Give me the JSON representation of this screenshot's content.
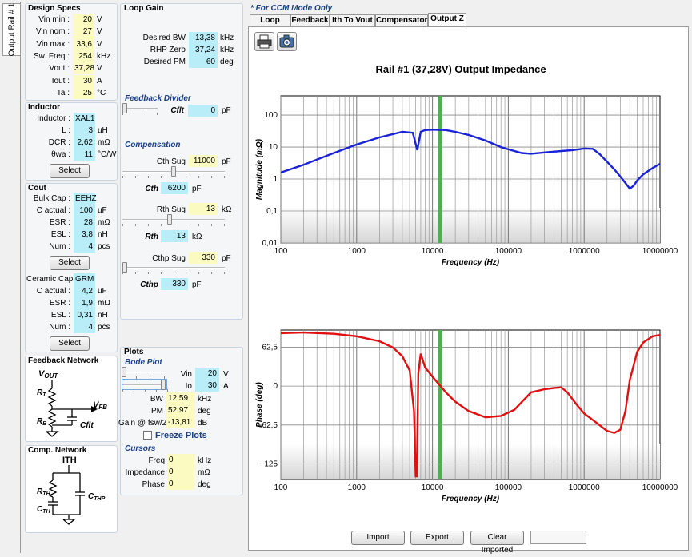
{
  "side_tab": "Output Rail # 1",
  "design_specs": {
    "title": "Design Specs",
    "rows": [
      {
        "label": "Vin min :",
        "value": "20",
        "unit": "V"
      },
      {
        "label": "Vin nom :",
        "value": "27",
        "unit": "V"
      },
      {
        "label": "Vin max :",
        "value": "33,6",
        "unit": "V"
      },
      {
        "label": "Sw. Freq :",
        "value": "254",
        "unit": "kHz"
      },
      {
        "label": "Vout :",
        "value": "37,28",
        "unit": "V"
      },
      {
        "label": "Iout :",
        "value": "30",
        "unit": "A"
      },
      {
        "label": "Ta :",
        "value": "25",
        "unit": "°C"
      }
    ]
  },
  "inductor": {
    "title": "Inductor",
    "rows": [
      {
        "label": "Inductor :",
        "value": "XAL1",
        "unit": ""
      },
      {
        "label": "L :",
        "value": "3",
        "unit": "uH"
      },
      {
        "label": "DCR :",
        "value": "2,62",
        "unit": "mΩ"
      },
      {
        "label": "θwa :",
        "value": "11",
        "unit": "°C/W"
      }
    ],
    "select": "Select"
  },
  "cout": {
    "title": "Cout",
    "bulk_rows": [
      {
        "label": "Bulk Cap :",
        "value": "EEHZ",
        "unit": ""
      },
      {
        "label": "C actual :",
        "value": "100",
        "unit": "uF"
      },
      {
        "label": "ESR :",
        "value": "28",
        "unit": "mΩ"
      },
      {
        "label": "ESL :",
        "value": "3,8",
        "unit": "nH"
      },
      {
        "label": "Num :",
        "value": "4",
        "unit": "pcs"
      }
    ],
    "bulk_select": "Select",
    "ceramic_rows": [
      {
        "label": "Ceramic Cap :",
        "value": "GRM",
        "unit": ""
      },
      {
        "label": "C actual :",
        "value": "4,2",
        "unit": "uF"
      },
      {
        "label": "ESR :",
        "value": "1,9",
        "unit": "mΩ"
      },
      {
        "label": "ESL :",
        "value": "0,31",
        "unit": "nH"
      },
      {
        "label": "Num :",
        "value": "4",
        "unit": "pcs"
      }
    ],
    "ceramic_select": "Select"
  },
  "feedback_network": {
    "title": "Feedback Network",
    "vout": "V",
    "vout_sub": "OUT",
    "rt": "R",
    "rt_sub": "T",
    "rb": "R",
    "rb_sub": "B",
    "vfb": "V",
    "vfb_sub": "FB",
    "cflt": "Cflt"
  },
  "comp_network": {
    "title": "Comp. Network",
    "ith": "ITH",
    "rth": "R",
    "rth_sub": "TH",
    "cth": "C",
    "cth_sub": "TH",
    "cthp": "C",
    "cthp_sub": "THP"
  },
  "loop_gain": {
    "title": "Loop Gain",
    "rows": [
      {
        "label": "Desired BW",
        "value": "13,38",
        "unit": "kHz"
      },
      {
        "label": "RHP Zero",
        "value": "37,24",
        "unit": "kHz"
      },
      {
        "label": "Desired PM",
        "value": "60",
        "unit": "deg"
      }
    ],
    "feedback_divider": "Feedback Divider",
    "cflt": {
      "label": "Cflt",
      "value": "0",
      "unit": "pF"
    },
    "compensation": "Compensation",
    "cth_sug": {
      "label": "Cth Sug",
      "value": "11000",
      "unit": "pF"
    },
    "cth": {
      "label": "Cth",
      "value": "6200",
      "unit": "pF"
    },
    "rth_sug": {
      "label": "Rth Sug",
      "value": "13",
      "unit": "kΩ"
    },
    "rth": {
      "label": "Rth",
      "value": "13",
      "unit": "kΩ"
    },
    "cthp_sug": {
      "label": "Cthp Sug",
      "value": "330",
      "unit": "pF"
    },
    "cthp": {
      "label": "Cthp",
      "value": "330",
      "unit": "pF"
    }
  },
  "plots": {
    "title": "Plots",
    "bode": "Bode Plot",
    "vin": {
      "label": "Vin",
      "value": "20",
      "unit": "V"
    },
    "io": {
      "label": "Io",
      "value": "30",
      "unit": "A"
    },
    "bw": {
      "label": "BW",
      "value": "12,59",
      "unit": "kHz"
    },
    "pm": {
      "label": "PM",
      "value": "52,97",
      "unit": "deg"
    },
    "gain": {
      "label": "Gain @ fsw/2",
      "value": "-13,81",
      "unit": "dB"
    },
    "freeze": "Freeze Plots",
    "cursors": "Cursors",
    "freq": {
      "label": "Freq",
      "value": "0",
      "unit": "kHz"
    },
    "impedance": {
      "label": "Impedance",
      "value": "0",
      "unit": "mΩ"
    },
    "phase": {
      "label": "Phase",
      "value": "0",
      "unit": "deg"
    }
  },
  "right_panel": {
    "ccm_note": "* For CCM Mode Only",
    "tabs": [
      "Loop Gain",
      "Feedback",
      "Ith To Vout",
      "Compensator",
      "Output Z"
    ],
    "active_tab": 4,
    "buttons": {
      "import": "Import",
      "export": "Export",
      "clear": "Clear Imported"
    }
  },
  "chart_data": [
    {
      "type": "line",
      "title": "Rail #1 (37,28V) Output Impedance",
      "xlabel": "Frequency (Hz)",
      "ylabel": "Magnitude (mΩ)",
      "xscale": "log",
      "yscale": "log",
      "xlim": [
        100,
        10000000
      ],
      "ylim": [
        0.01,
        400
      ],
      "x_ticks": [
        "100",
        "1000",
        "10000",
        "100000",
        "1000000",
        "10000000"
      ],
      "y_ticks": [
        "0,01",
        "0,1",
        "1",
        "10",
        "100"
      ],
      "marker_frequency": 12590,
      "series": [
        {
          "color": "#1a22d6",
          "x": [
            100,
            200,
            500,
            1000,
            2000,
            4000,
            5500,
            6300,
            7000,
            8000,
            10000,
            15000,
            20000,
            30000,
            50000,
            80000,
            100000,
            150000,
            200000,
            300000,
            500000,
            700000,
            1000000,
            1300000,
            1600000,
            2000000,
            2500000,
            3000000,
            3500000,
            4000000,
            4500000,
            5000000,
            6000000,
            8000000,
            10000000
          ],
          "y": [
            1.6,
            2.8,
            6.5,
            12,
            20,
            30,
            28,
            8,
            30,
            34,
            35,
            34,
            30,
            24,
            16,
            10,
            8.5,
            6.5,
            6.2,
            6.8,
            7.5,
            8,
            9,
            8.8,
            6,
            3.5,
            2,
            1.2,
            0.75,
            0.5,
            0.62,
            0.9,
            1.4,
            2.2,
            3
          ]
        }
      ]
    },
    {
      "type": "line",
      "xlabel": "Frequency (Hz)",
      "ylabel": "Phase (deg)",
      "xscale": "log",
      "xlim": [
        100,
        10000000
      ],
      "ylim": [
        -150,
        90
      ],
      "x_ticks": [
        "100",
        "1000",
        "10000",
        "100000",
        "1000000",
        "10000000"
      ],
      "y_ticks": [
        "62,5",
        "0",
        "-62,5",
        "-125"
      ],
      "marker_frequency": 12590,
      "series": [
        {
          "color": "#e01010",
          "x": [
            100,
            200,
            500,
            1000,
            2000,
            3000,
            4000,
            5000,
            5700,
            6000,
            6200,
            6500,
            7000,
            8000,
            10000,
            15000,
            20000,
            30000,
            50000,
            80000,
            120000,
            200000,
            300000,
            400000,
            500000,
            600000,
            800000,
            1000000,
            1500000,
            2000000,
            2500000,
            3000000,
            3500000,
            4000000,
            5000000,
            6000000,
            8000000,
            10000000
          ],
          "y": [
            85,
            86,
            84,
            80,
            72,
            62,
            48,
            25,
            -40,
            -145,
            -145,
            20,
            52,
            30,
            15,
            -10,
            -25,
            -40,
            -50,
            -48,
            -38,
            -10,
            -5,
            -3,
            -2,
            -10,
            -30,
            -44,
            -60,
            -72,
            -75,
            -70,
            -40,
            10,
            55,
            70,
            80,
            82
          ]
        }
      ]
    }
  ]
}
